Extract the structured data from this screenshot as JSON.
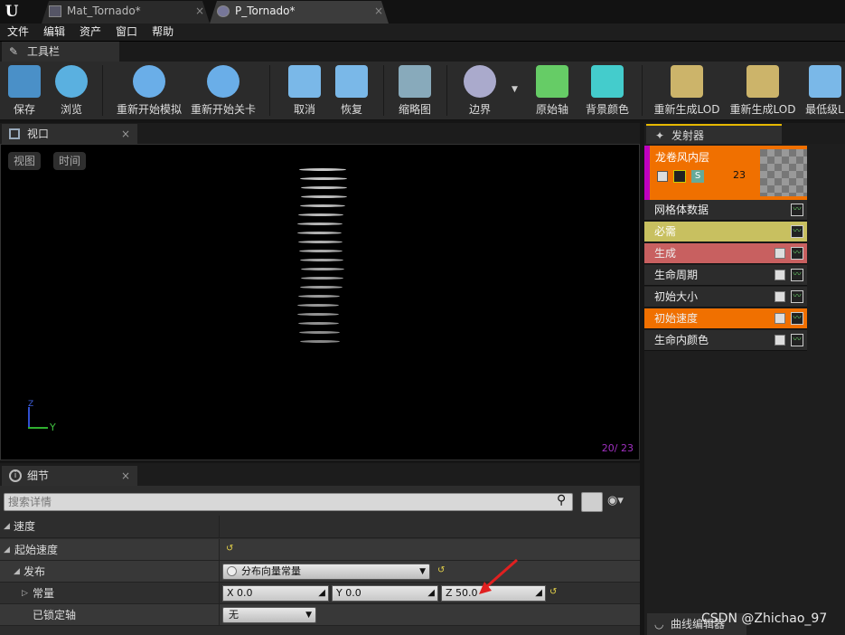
{
  "tabs": [
    {
      "label": "Mat_Tornado*",
      "close": "×"
    },
    {
      "label": "P_Tornado*",
      "close": "×"
    }
  ],
  "menu": [
    "文件",
    "编辑",
    "资产",
    "窗口",
    "帮助"
  ],
  "toolbar_tab": {
    "label": "工具栏",
    "close": "×"
  },
  "toolbar": [
    {
      "label": "保存",
      "icon": "save-icon",
      "color": "#4a90c8"
    },
    {
      "label": "浏览",
      "icon": "browse-icon",
      "color": "#5ab0e0"
    },
    {
      "label": "重新开始模拟",
      "icon": "restart-sim-icon",
      "color": "#6aaee8"
    },
    {
      "label": "重新开始关卡",
      "icon": "restart-level-icon",
      "color": "#6aaee8"
    },
    {
      "label": "取消",
      "icon": "undo-icon",
      "color": "#7ab8e8"
    },
    {
      "label": "恢复",
      "icon": "redo-icon",
      "color": "#7ab8e8"
    },
    {
      "label": "缩略图",
      "icon": "thumbnail-icon",
      "color": "#8ab"
    },
    {
      "label": "边界",
      "icon": "bounds-icon",
      "color": "#aac"
    },
    {
      "label": "原始轴",
      "icon": "origin-axis-icon",
      "color": "#6c6"
    },
    {
      "label": "背景颜色",
      "icon": "bg-color-icon",
      "color": "#4cc"
    },
    {
      "label": "重新生成LOD",
      "icon": "regen-lod-icon",
      "color": "#ccb46a"
    },
    {
      "label": "重新生成LOD",
      "icon": "regen-lod2-icon",
      "color": "#ccb46a"
    },
    {
      "label": "最低级L",
      "icon": "lowest-lod-icon",
      "color": "#7ab8e8"
    }
  ],
  "viewport": {
    "tab": "视口",
    "close": "×",
    "view_btn": "视图",
    "time_btn": "时间",
    "count": "20/ 23",
    "axis_z": "Z",
    "axis_y": "Y"
  },
  "details": {
    "tab": "细节",
    "close": "×",
    "search_placeholder": "搜索详情",
    "category": "速度",
    "rows": {
      "start_velocity": "起始速度",
      "distribution": "发布",
      "distribution_value": "分布向量常量",
      "constant": "常量",
      "x": "X  0.0",
      "y": "Y  0.0",
      "z": "Z   50.0",
      "locked_axis": "已锁定轴",
      "locked_axis_value": "无"
    }
  },
  "emitter": {
    "tab": "发射器",
    "name": "龙卷风内层",
    "count": "23",
    "modules": [
      {
        "label": "网格体数据",
        "color": "#2c2c2c"
      },
      {
        "label": "必需",
        "color": "#c8c060"
      },
      {
        "label": "生成",
        "color": "#c86060"
      },
      {
        "label": "生命周期",
        "color": "#2c2c2c"
      },
      {
        "label": "初始大小",
        "color": "#2c2c2c"
      },
      {
        "label": "初始速度",
        "color": "#f07000"
      },
      {
        "label": "生命内颜色",
        "color": "#2c2c2c"
      }
    ]
  },
  "curve_editor_tab": "曲线编辑器",
  "watermark": "CSDN @Zhichao_97"
}
